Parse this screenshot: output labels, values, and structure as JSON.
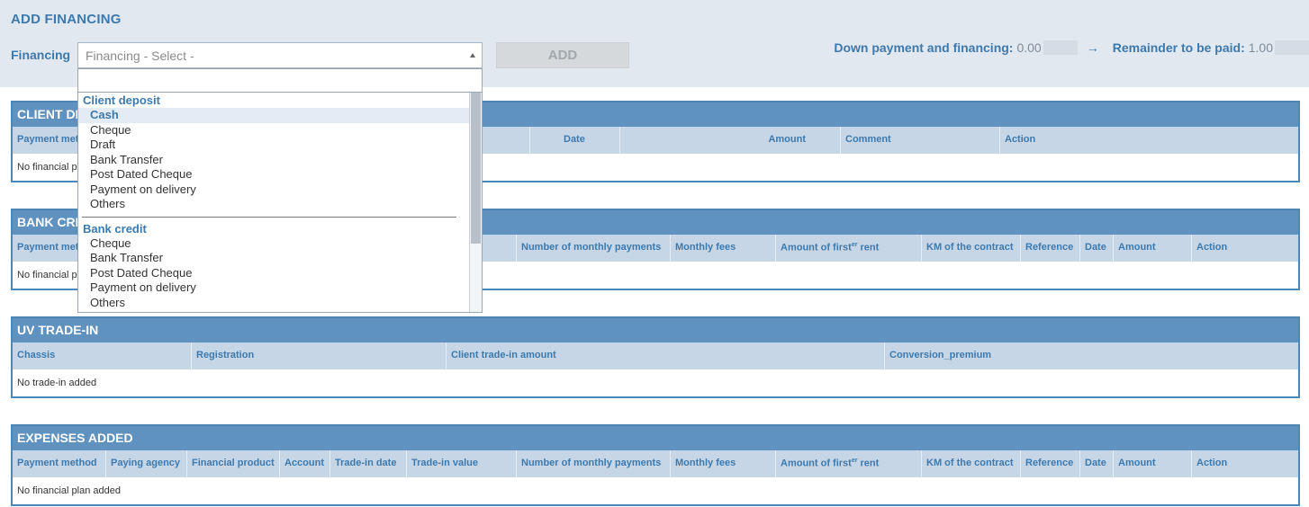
{
  "header": {
    "title": "ADD FINANCING",
    "financing_label": "Financing",
    "select_placeholder": "Financing - Select -",
    "add_label": "ADD",
    "down_payment_label": "Down payment and financing:",
    "down_payment_value": "0.00",
    "arrow": "→",
    "remainder_label": "Remainder to be paid:",
    "remainder_value": "1.00"
  },
  "dropdown": {
    "groups": [
      {
        "label": "Client deposit",
        "options": [
          "Cash",
          "Cheque",
          "Draft",
          "Bank Transfer",
          "Post Dated Cheque",
          "Payment on delivery",
          "Others"
        ],
        "highlighted": "Cash"
      },
      {
        "label": "Bank credit",
        "options": [
          "Cheque",
          "Bank Transfer",
          "Post Dated Cheque",
          "Payment on delivery",
          "Others"
        ]
      }
    ]
  },
  "client_deposit": {
    "title": "CLIENT DE",
    "columns": [
      "Payment met",
      "Date",
      "Amount",
      "Comment",
      "Action"
    ],
    "empty": "No financial p"
  },
  "bank_credit": {
    "title": "BANK CRE",
    "columns": [
      "Payment met",
      "Number of monthly payments",
      "Monthly fees",
      "Amount of first",
      "er",
      " rent",
      "KM of the contract",
      "Reference",
      "Date",
      "Amount",
      "Action"
    ],
    "empty": "No financial p"
  },
  "uv_trade_in": {
    "title": "UV TRADE-IN",
    "columns": [
      "Chassis",
      "Registration",
      "Client trade-in amount",
      "Conversion_premium"
    ],
    "empty": "No trade-in added"
  },
  "expenses": {
    "title": "EXPENSES ADDED",
    "columns": [
      "Payment method",
      "Paying agency",
      "Financial product",
      "Account",
      "Trade-in date",
      "Trade-in value",
      "Number of monthly payments",
      "Monthly fees",
      "Amount of first",
      "er",
      " rent",
      "KM of the contract",
      "Reference",
      "Date",
      "Amount",
      "Action"
    ],
    "empty": "No financial plan added"
  },
  "colors": {
    "header_bg": "#e1e8f0",
    "accent": "#3c79ad",
    "panel_head": "#5f92bf",
    "cols_bg": "#c7d6e6"
  }
}
